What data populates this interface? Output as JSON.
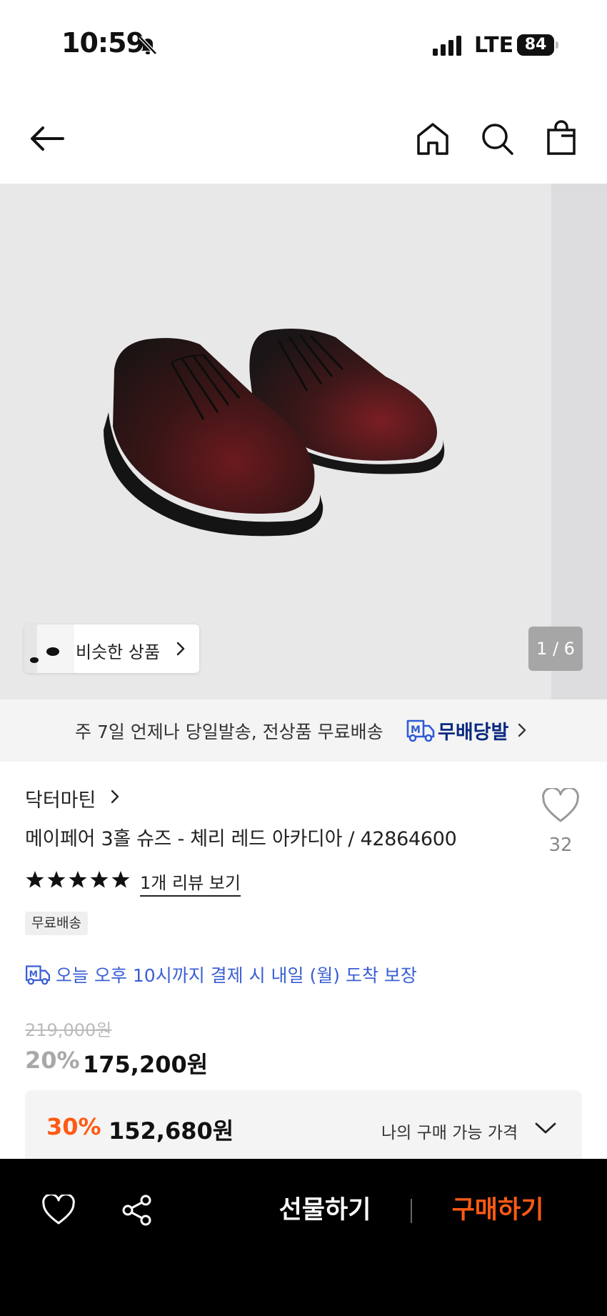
{
  "status_bar": {
    "time": "10:59",
    "network": "LTE",
    "battery": "84"
  },
  "nav": {
    "back_icon": "arrow-left-icon",
    "home_icon": "home-icon",
    "search_icon": "search-icon",
    "cart_icon": "shopping-bag-icon"
  },
  "gallery": {
    "similar_label": "비슷한 상품",
    "page_indicator": "1 / 6"
  },
  "delivery_banner": {
    "text": "주 7일 언제나 당일발송, 전상품 무료배송",
    "badge": "무배당발",
    "accent": "#0b2a80"
  },
  "product": {
    "brand": "닥터마틴",
    "title": "메이페어 3홀 슈즈 - 체리 레드 아카디아 / 42864600",
    "like_count": "32",
    "rating": 5,
    "review_link": "1개 리뷰 보기",
    "free_shipping_badge": "무료배송",
    "arrival_text": "오늘 오후 10시까지 결제 시 내일 (월) 도착 보장",
    "original_price": "219,000원",
    "discount_rate": "20%",
    "sale_price": "175,200원",
    "my_price": {
      "discount_rate": "30%",
      "price": "152,680원",
      "label": "나의 구매 가능 가격"
    }
  },
  "bottom_bar": {
    "gift_label": "선물하기",
    "buy_label": "구매하기",
    "buy_color": "#ff5a14"
  }
}
